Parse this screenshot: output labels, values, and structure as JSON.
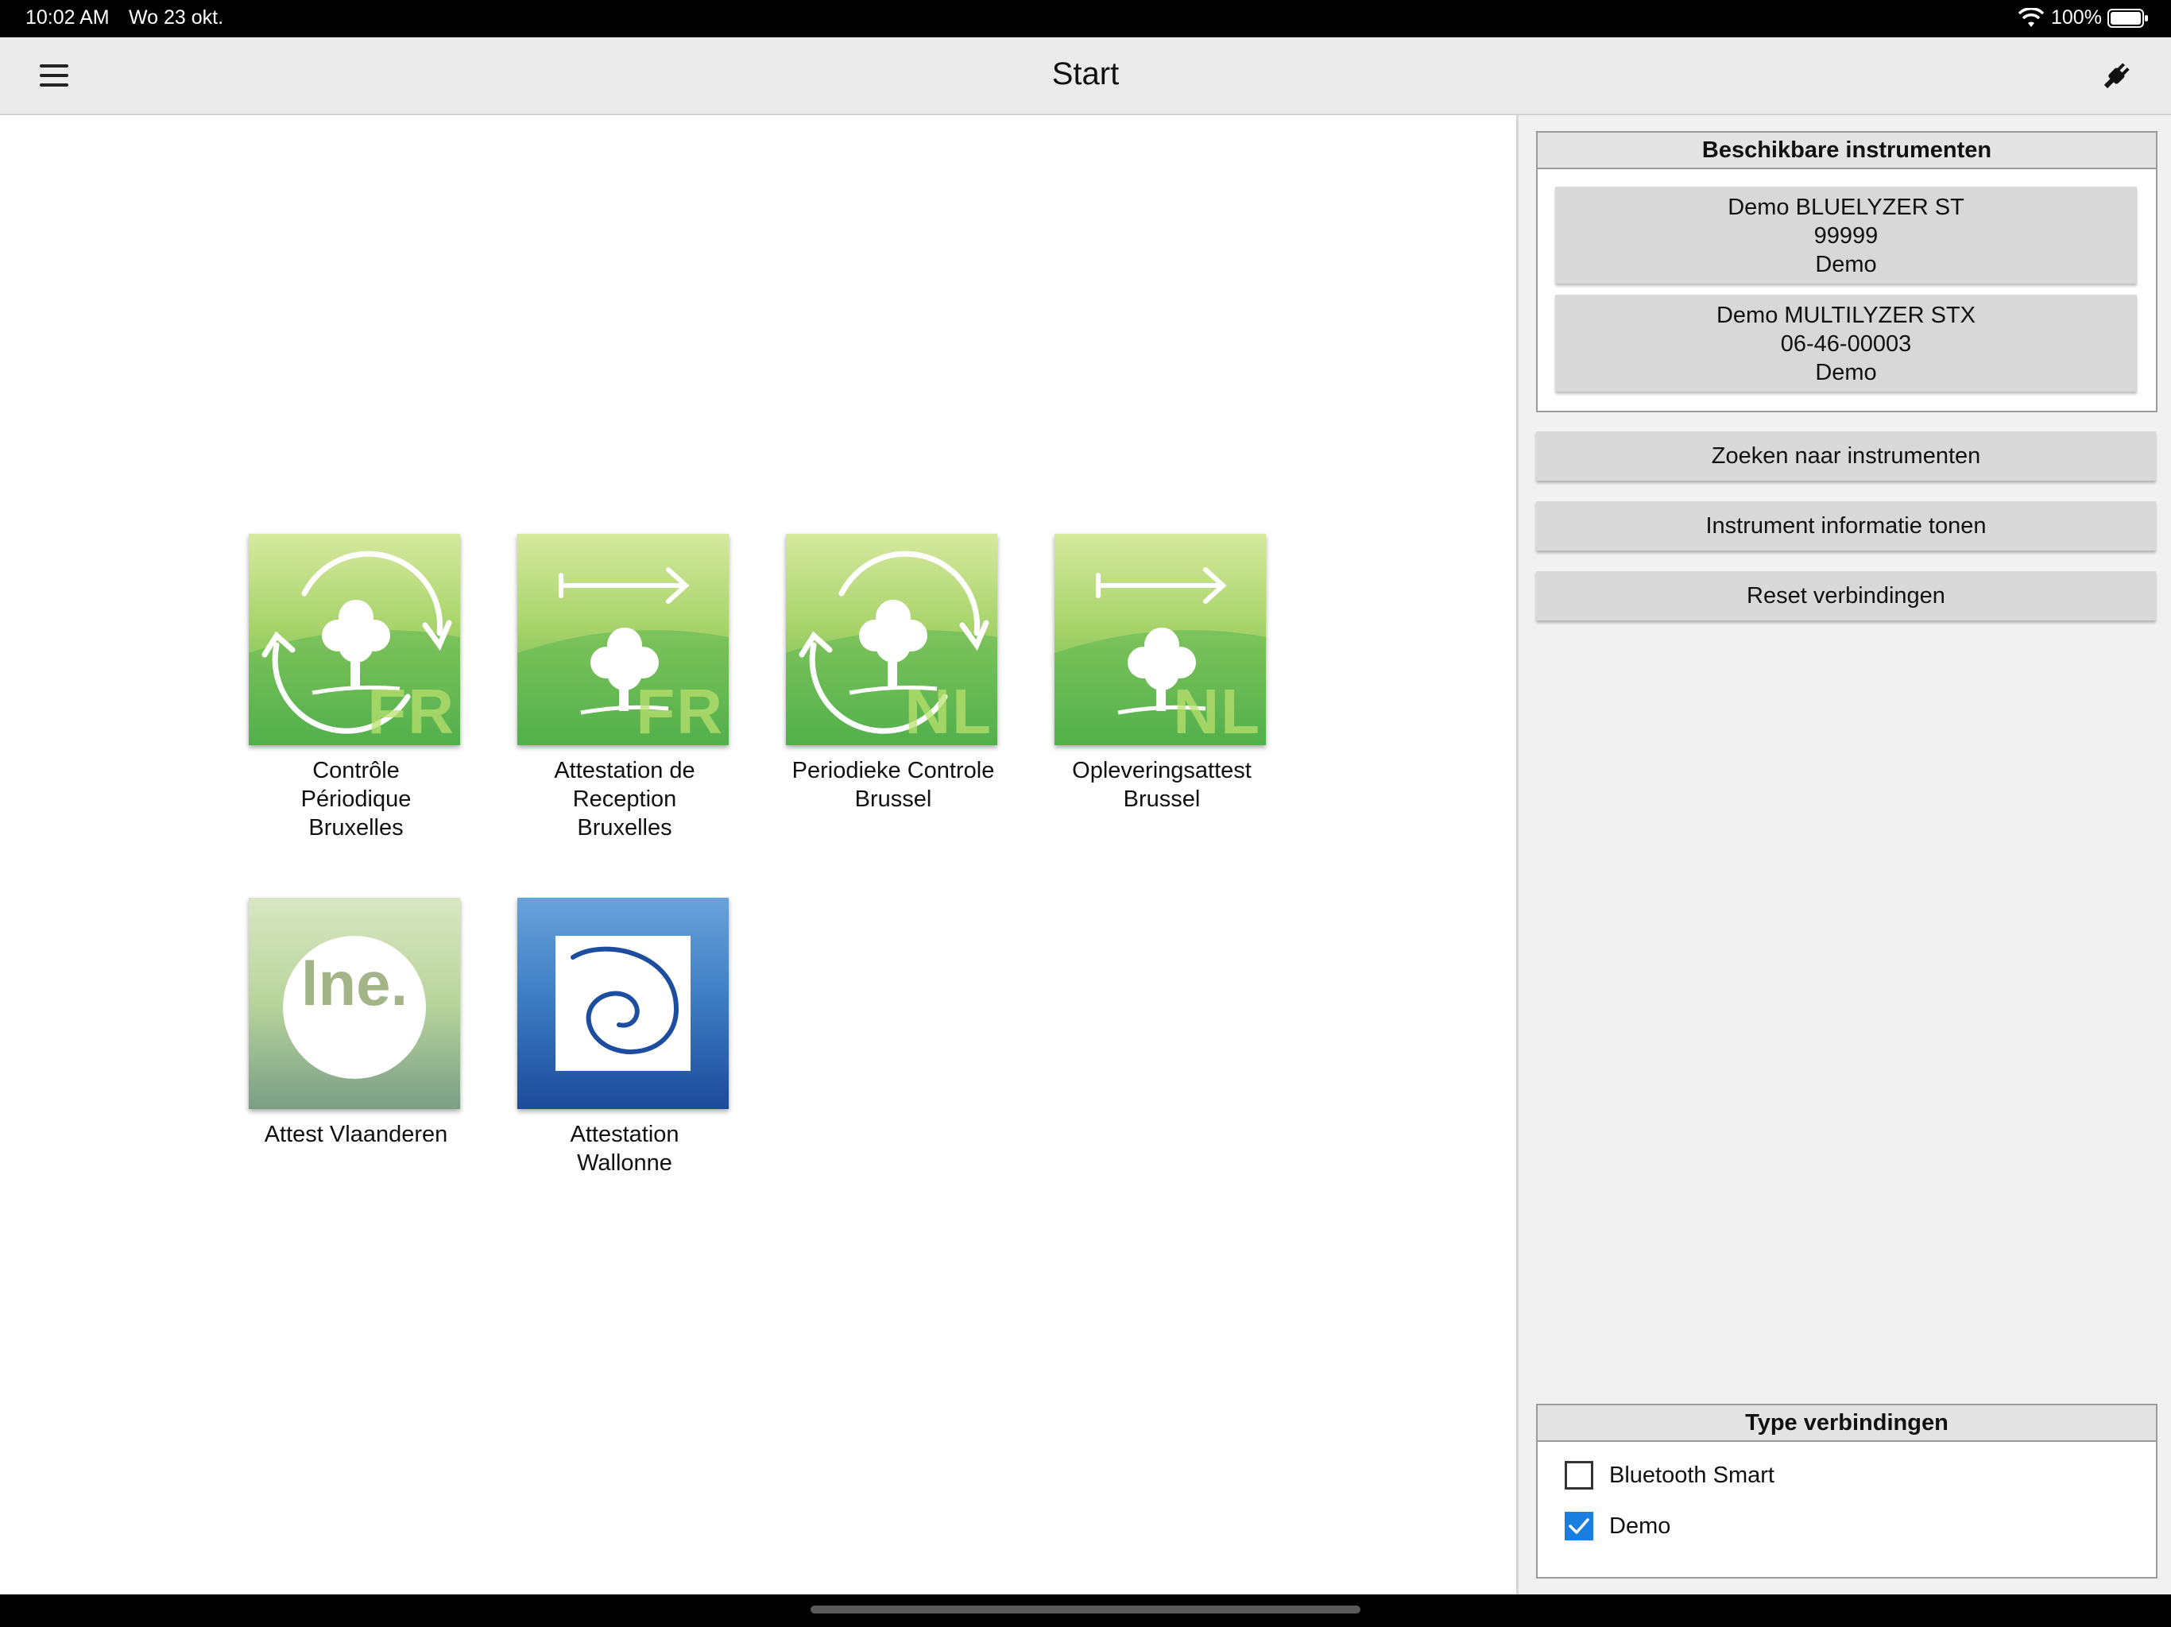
{
  "status_bar": {
    "time": "10:02 AM",
    "date": "Wo 23 okt.",
    "battery_percent": "100%",
    "battery_level": 1.0,
    "wifi_icon": "wifi-icon",
    "battery_icon": "battery-icon"
  },
  "nav": {
    "title": "Start",
    "menu_icon": "hamburger-menu-icon",
    "connection_icon": "plug-icon"
  },
  "tiles": [
    {
      "label": "Contrôle Périodique Bruxelles",
      "icon": "cycle-tree-icon",
      "lang": "FR"
    },
    {
      "label": "Attestation de Reception Bruxelles",
      "icon": "arrow-tree-icon",
      "lang": "FR"
    },
    {
      "label": "Periodieke Controle Brussel",
      "icon": "cycle-tree-icon",
      "lang": "NL"
    },
    {
      "label": "Opleveringsattest Brussel",
      "icon": "arrow-tree-icon",
      "lang": "NL"
    },
    {
      "label": "Attest Vlaanderen",
      "icon": "lne-logo-icon",
      "logo_text": "lne."
    },
    {
      "label": "Attestation Wallonne",
      "icon": "spiral-logo-icon"
    }
  ],
  "panel": {
    "instruments_title": "Beschikbare instrumenten",
    "instruments": [
      {
        "name": "Demo BLUELYZER ST",
        "serial": "99999",
        "type": "Demo"
      },
      {
        "name": "Demo MULTILYZER STX",
        "serial": "06-46-00003",
        "type": "Demo"
      }
    ],
    "buttons": {
      "search": "Zoeken naar instrumenten",
      "info": "Instrument informatie tonen",
      "reset": "Reset verbindingen"
    },
    "connections_title": "Type verbindingen",
    "connections": [
      {
        "label": "Bluetooth Smart",
        "checked": false
      },
      {
        "label": "Demo",
        "checked": true
      }
    ]
  },
  "colors": {
    "accent_blue": "#1a7ee0",
    "tile_green_top": "#d3e79a",
    "tile_green_bottom": "#4aae48",
    "tile_blue_top": "#5f98d4",
    "tile_blue_bottom": "#1d4d9e"
  }
}
